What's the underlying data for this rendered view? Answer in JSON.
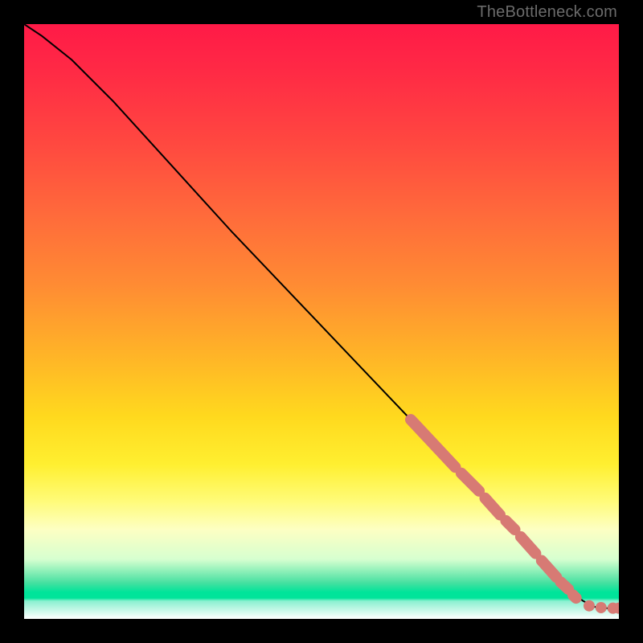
{
  "watermark": "TheBottleneck.com",
  "colors": {
    "curve": "#000000",
    "marker": "#d77a74",
    "frame_bg": "#000000"
  },
  "chart_data": {
    "type": "line",
    "title": "",
    "xlabel": "",
    "ylabel": "",
    "xlim": [
      0,
      100
    ],
    "ylim": [
      0,
      100
    ],
    "grid": false,
    "legend": false,
    "series": [
      {
        "name": "curve",
        "x": [
          0,
          3,
          8,
          15,
          25,
          35,
          45,
          55,
          65,
          72,
          78,
          83,
          87,
          90,
          92,
          94,
          96,
          98,
          100
        ],
        "y": [
          100,
          98,
          94,
          87,
          76,
          65,
          54.5,
          44,
          33.5,
          26,
          20,
          14.5,
          10,
          6.5,
          4.5,
          3,
          2,
          1.8,
          1.8
        ]
      }
    ],
    "highlight_segments": [
      {
        "x0": 65,
        "y0": 33.5,
        "x1": 72.5,
        "y1": 25.5
      },
      {
        "x0": 73.5,
        "y0": 24.5,
        "x1": 76.5,
        "y1": 21.5
      },
      {
        "x0": 77.5,
        "y0": 20.3,
        "x1": 80.0,
        "y1": 17.5
      },
      {
        "x0": 81.0,
        "y0": 16.5,
        "x1": 82.5,
        "y1": 15.0
      },
      {
        "x0": 83.5,
        "y0": 13.8,
        "x1": 86.0,
        "y1": 11.0
      },
      {
        "x0": 87.0,
        "y0": 9.8,
        "x1": 89.5,
        "y1": 7.0
      },
      {
        "x0": 90.2,
        "y0": 6.2,
        "x1": 91.5,
        "y1": 5.0
      },
      {
        "x0": 92.3,
        "y0": 4.0,
        "x1": 92.8,
        "y1": 3.5
      }
    ],
    "highlight_points": [
      {
        "x": 95.0,
        "y": 2.2
      },
      {
        "x": 97.0,
        "y": 1.9
      },
      {
        "x": 99.0,
        "y": 1.8
      },
      {
        "x": 100.0,
        "y": 1.8
      }
    ]
  }
}
